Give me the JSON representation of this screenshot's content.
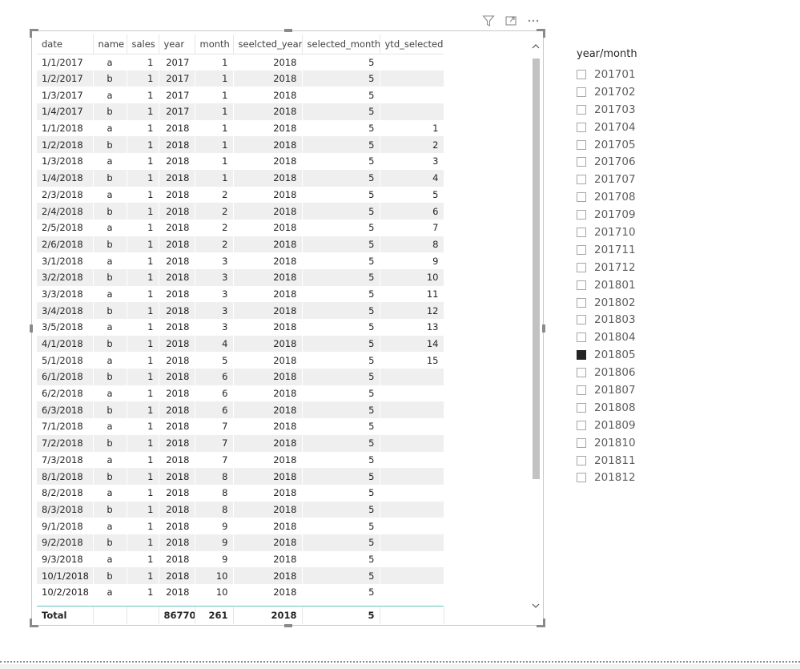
{
  "header_icons": [
    "filter-icon",
    "focus-mode-icon",
    "more-options-icon"
  ],
  "table": {
    "columns": [
      "date",
      "name",
      "sales",
      "year",
      "month",
      "seelcted_year",
      "selected_month",
      "ytd_selected"
    ],
    "rows": [
      [
        "1/1/2017",
        "a",
        "1",
        "2017",
        "1",
        "2018",
        "5",
        ""
      ],
      [
        "1/2/2017",
        "b",
        "1",
        "2017",
        "1",
        "2018",
        "5",
        ""
      ],
      [
        "1/3/2017",
        "a",
        "1",
        "2017",
        "1",
        "2018",
        "5",
        ""
      ],
      [
        "1/4/2017",
        "b",
        "1",
        "2017",
        "1",
        "2018",
        "5",
        ""
      ],
      [
        "1/1/2018",
        "a",
        "1",
        "2018",
        "1",
        "2018",
        "5",
        "1"
      ],
      [
        "1/2/2018",
        "b",
        "1",
        "2018",
        "1",
        "2018",
        "5",
        "2"
      ],
      [
        "1/3/2018",
        "a",
        "1",
        "2018",
        "1",
        "2018",
        "5",
        "3"
      ],
      [
        "1/4/2018",
        "b",
        "1",
        "2018",
        "1",
        "2018",
        "5",
        "4"
      ],
      [
        "2/3/2018",
        "a",
        "1",
        "2018",
        "2",
        "2018",
        "5",
        "5"
      ],
      [
        "2/4/2018",
        "b",
        "1",
        "2018",
        "2",
        "2018",
        "5",
        "6"
      ],
      [
        "2/5/2018",
        "a",
        "1",
        "2018",
        "2",
        "2018",
        "5",
        "7"
      ],
      [
        "2/6/2018",
        "b",
        "1",
        "2018",
        "2",
        "2018",
        "5",
        "8"
      ],
      [
        "3/1/2018",
        "a",
        "1",
        "2018",
        "3",
        "2018",
        "5",
        "9"
      ],
      [
        "3/2/2018",
        "b",
        "1",
        "2018",
        "3",
        "2018",
        "5",
        "10"
      ],
      [
        "3/3/2018",
        "a",
        "1",
        "2018",
        "3",
        "2018",
        "5",
        "11"
      ],
      [
        "3/4/2018",
        "b",
        "1",
        "2018",
        "3",
        "2018",
        "5",
        "12"
      ],
      [
        "3/5/2018",
        "a",
        "1",
        "2018",
        "3",
        "2018",
        "5",
        "13"
      ],
      [
        "4/1/2018",
        "b",
        "1",
        "2018",
        "4",
        "2018",
        "5",
        "14"
      ],
      [
        "5/1/2018",
        "a",
        "1",
        "2018",
        "5",
        "2018",
        "5",
        "15"
      ],
      [
        "6/1/2018",
        "b",
        "1",
        "2018",
        "6",
        "2018",
        "5",
        ""
      ],
      [
        "6/2/2018",
        "a",
        "1",
        "2018",
        "6",
        "2018",
        "5",
        ""
      ],
      [
        "6/3/2018",
        "b",
        "1",
        "2018",
        "6",
        "2018",
        "5",
        ""
      ],
      [
        "7/1/2018",
        "a",
        "1",
        "2018",
        "7",
        "2018",
        "5",
        ""
      ],
      [
        "7/2/2018",
        "b",
        "1",
        "2018",
        "7",
        "2018",
        "5",
        ""
      ],
      [
        "7/3/2018",
        "a",
        "1",
        "2018",
        "7",
        "2018",
        "5",
        ""
      ],
      [
        "8/1/2018",
        "b",
        "1",
        "2018",
        "8",
        "2018",
        "5",
        ""
      ],
      [
        "8/2/2018",
        "a",
        "1",
        "2018",
        "8",
        "2018",
        "5",
        ""
      ],
      [
        "8/3/2018",
        "b",
        "1",
        "2018",
        "8",
        "2018",
        "5",
        ""
      ],
      [
        "9/1/2018",
        "a",
        "1",
        "2018",
        "9",
        "2018",
        "5",
        ""
      ],
      [
        "9/2/2018",
        "b",
        "1",
        "2018",
        "9",
        "2018",
        "5",
        ""
      ],
      [
        "9/3/2018",
        "a",
        "1",
        "2018",
        "9",
        "2018",
        "5",
        ""
      ],
      [
        "10/1/2018",
        "b",
        "1",
        "2018",
        "10",
        "2018",
        "5",
        ""
      ],
      [
        "10/2/2018",
        "a",
        "1",
        "2018",
        "10",
        "2018",
        "5",
        ""
      ]
    ],
    "total": [
      "Total",
      "",
      "",
      "86770",
      "261",
      "2018",
      "5",
      ""
    ]
  },
  "slicer": {
    "title": "year/month",
    "items": [
      {
        "label": "201701",
        "checked": false
      },
      {
        "label": "201702",
        "checked": false
      },
      {
        "label": "201703",
        "checked": false
      },
      {
        "label": "201704",
        "checked": false
      },
      {
        "label": "201705",
        "checked": false
      },
      {
        "label": "201706",
        "checked": false
      },
      {
        "label": "201707",
        "checked": false
      },
      {
        "label": "201708",
        "checked": false
      },
      {
        "label": "201709",
        "checked": false
      },
      {
        "label": "201710",
        "checked": false
      },
      {
        "label": "201711",
        "checked": false
      },
      {
        "label": "201712",
        "checked": false
      },
      {
        "label": "201801",
        "checked": false
      },
      {
        "label": "201802",
        "checked": false
      },
      {
        "label": "201803",
        "checked": false
      },
      {
        "label": "201804",
        "checked": false
      },
      {
        "label": "201805",
        "checked": true
      },
      {
        "label": "201806",
        "checked": false
      },
      {
        "label": "201807",
        "checked": false
      },
      {
        "label": "201808",
        "checked": false
      },
      {
        "label": "201809",
        "checked": false
      },
      {
        "label": "201810",
        "checked": false
      },
      {
        "label": "201811",
        "checked": false
      },
      {
        "label": "201812",
        "checked": false
      }
    ]
  }
}
